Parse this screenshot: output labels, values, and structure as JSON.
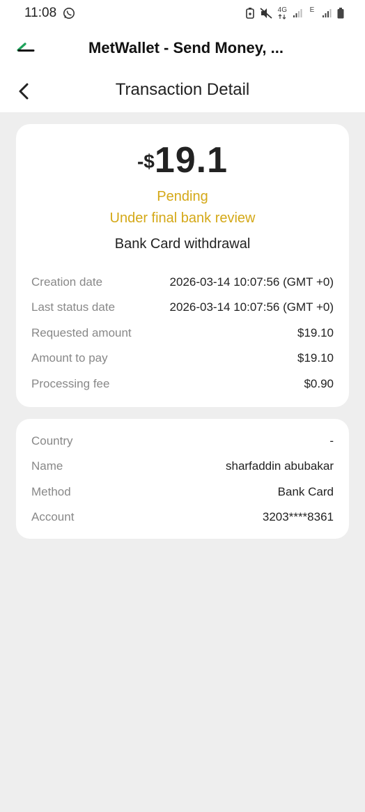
{
  "statusbar": {
    "time": "11:08",
    "network_label": "4G",
    "network_label_2": "E"
  },
  "appbar": {
    "title": "MetWallet - Send Money, ..."
  },
  "navbar": {
    "title": "Transaction Detail"
  },
  "transaction": {
    "amount_prefix": "-$",
    "amount_value": "19.1",
    "status": "Pending",
    "status_detail": "Under final bank review",
    "type": "Bank Card withdrawal",
    "status_color": "#d4a817",
    "details": [
      {
        "label": "Creation date",
        "value": "2026-03-14 10:07:56 (GMT +0)"
      },
      {
        "label": "Last status date",
        "value": "2026-03-14 10:07:56 (GMT +0)"
      },
      {
        "label": "Requested amount",
        "value": "$19.10"
      },
      {
        "label": "Amount to pay",
        "value": "$19.10"
      },
      {
        "label": "Processing fee",
        "value": "$0.90"
      }
    ]
  },
  "recipient": {
    "details": [
      {
        "label": "Country",
        "value": "-"
      },
      {
        "label": "Name",
        "value": "sharfaddin abubakar"
      },
      {
        "label": "Method",
        "value": "Bank Card"
      },
      {
        "label": "Account",
        "value": "3203****8361"
      }
    ]
  },
  "icons": {
    "back": "chevron-left-icon",
    "whatsapp": "whatsapp-icon",
    "logo": "metwallet-logo"
  }
}
